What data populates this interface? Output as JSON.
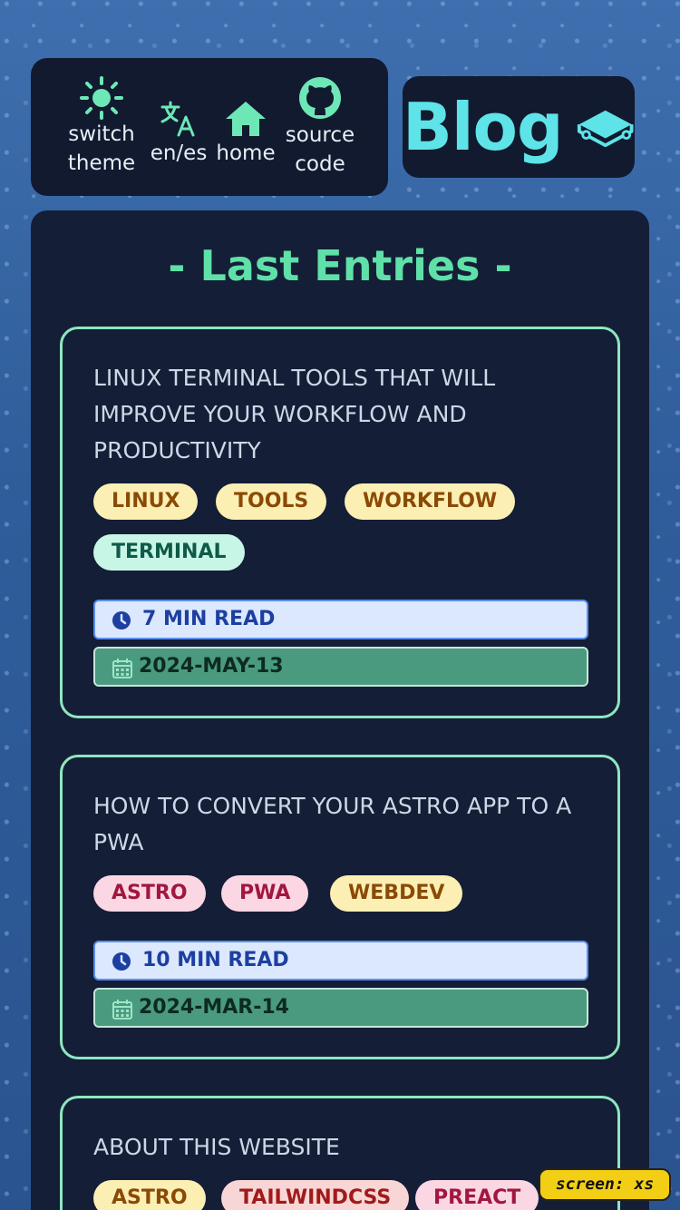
{
  "nav": {
    "switch_theme": "switch\ntheme",
    "language": "en/es",
    "home": "home",
    "source_code": "source\ncode"
  },
  "brand": {
    "title": "Blog",
    "icon": "book-icon"
  },
  "main": {
    "section_title": "- Last Entries -",
    "entries": [
      {
        "title": "LINUX TERMINAL TOOLS THAT WILL IMPROVE YOUR WORKFLOW AND PRODUCTIVITY",
        "tags": [
          "LINUX",
          "TOOLS",
          "WORKFLOW",
          "TERMINAL"
        ],
        "read_time": "7 MIN READ",
        "date": "2024-MAY-13"
      },
      {
        "title": "HOW TO CONVERT YOUR ASTRO APP TO A PWA",
        "tags": [
          "ASTRO",
          "PWA",
          "WEBDEV"
        ],
        "read_time": "10 MIN READ",
        "date": "2024-MAR-14"
      },
      {
        "title": "ABOUT THIS WEBSITE",
        "tags": [
          "ASTRO",
          "TAILWINDCSS",
          "PREACT"
        ]
      }
    ]
  },
  "screen_indicator": "screen: xs",
  "colors": {
    "accent": "#5fe0a8",
    "brand": "#5ee4e8",
    "panel": "#141e36"
  }
}
